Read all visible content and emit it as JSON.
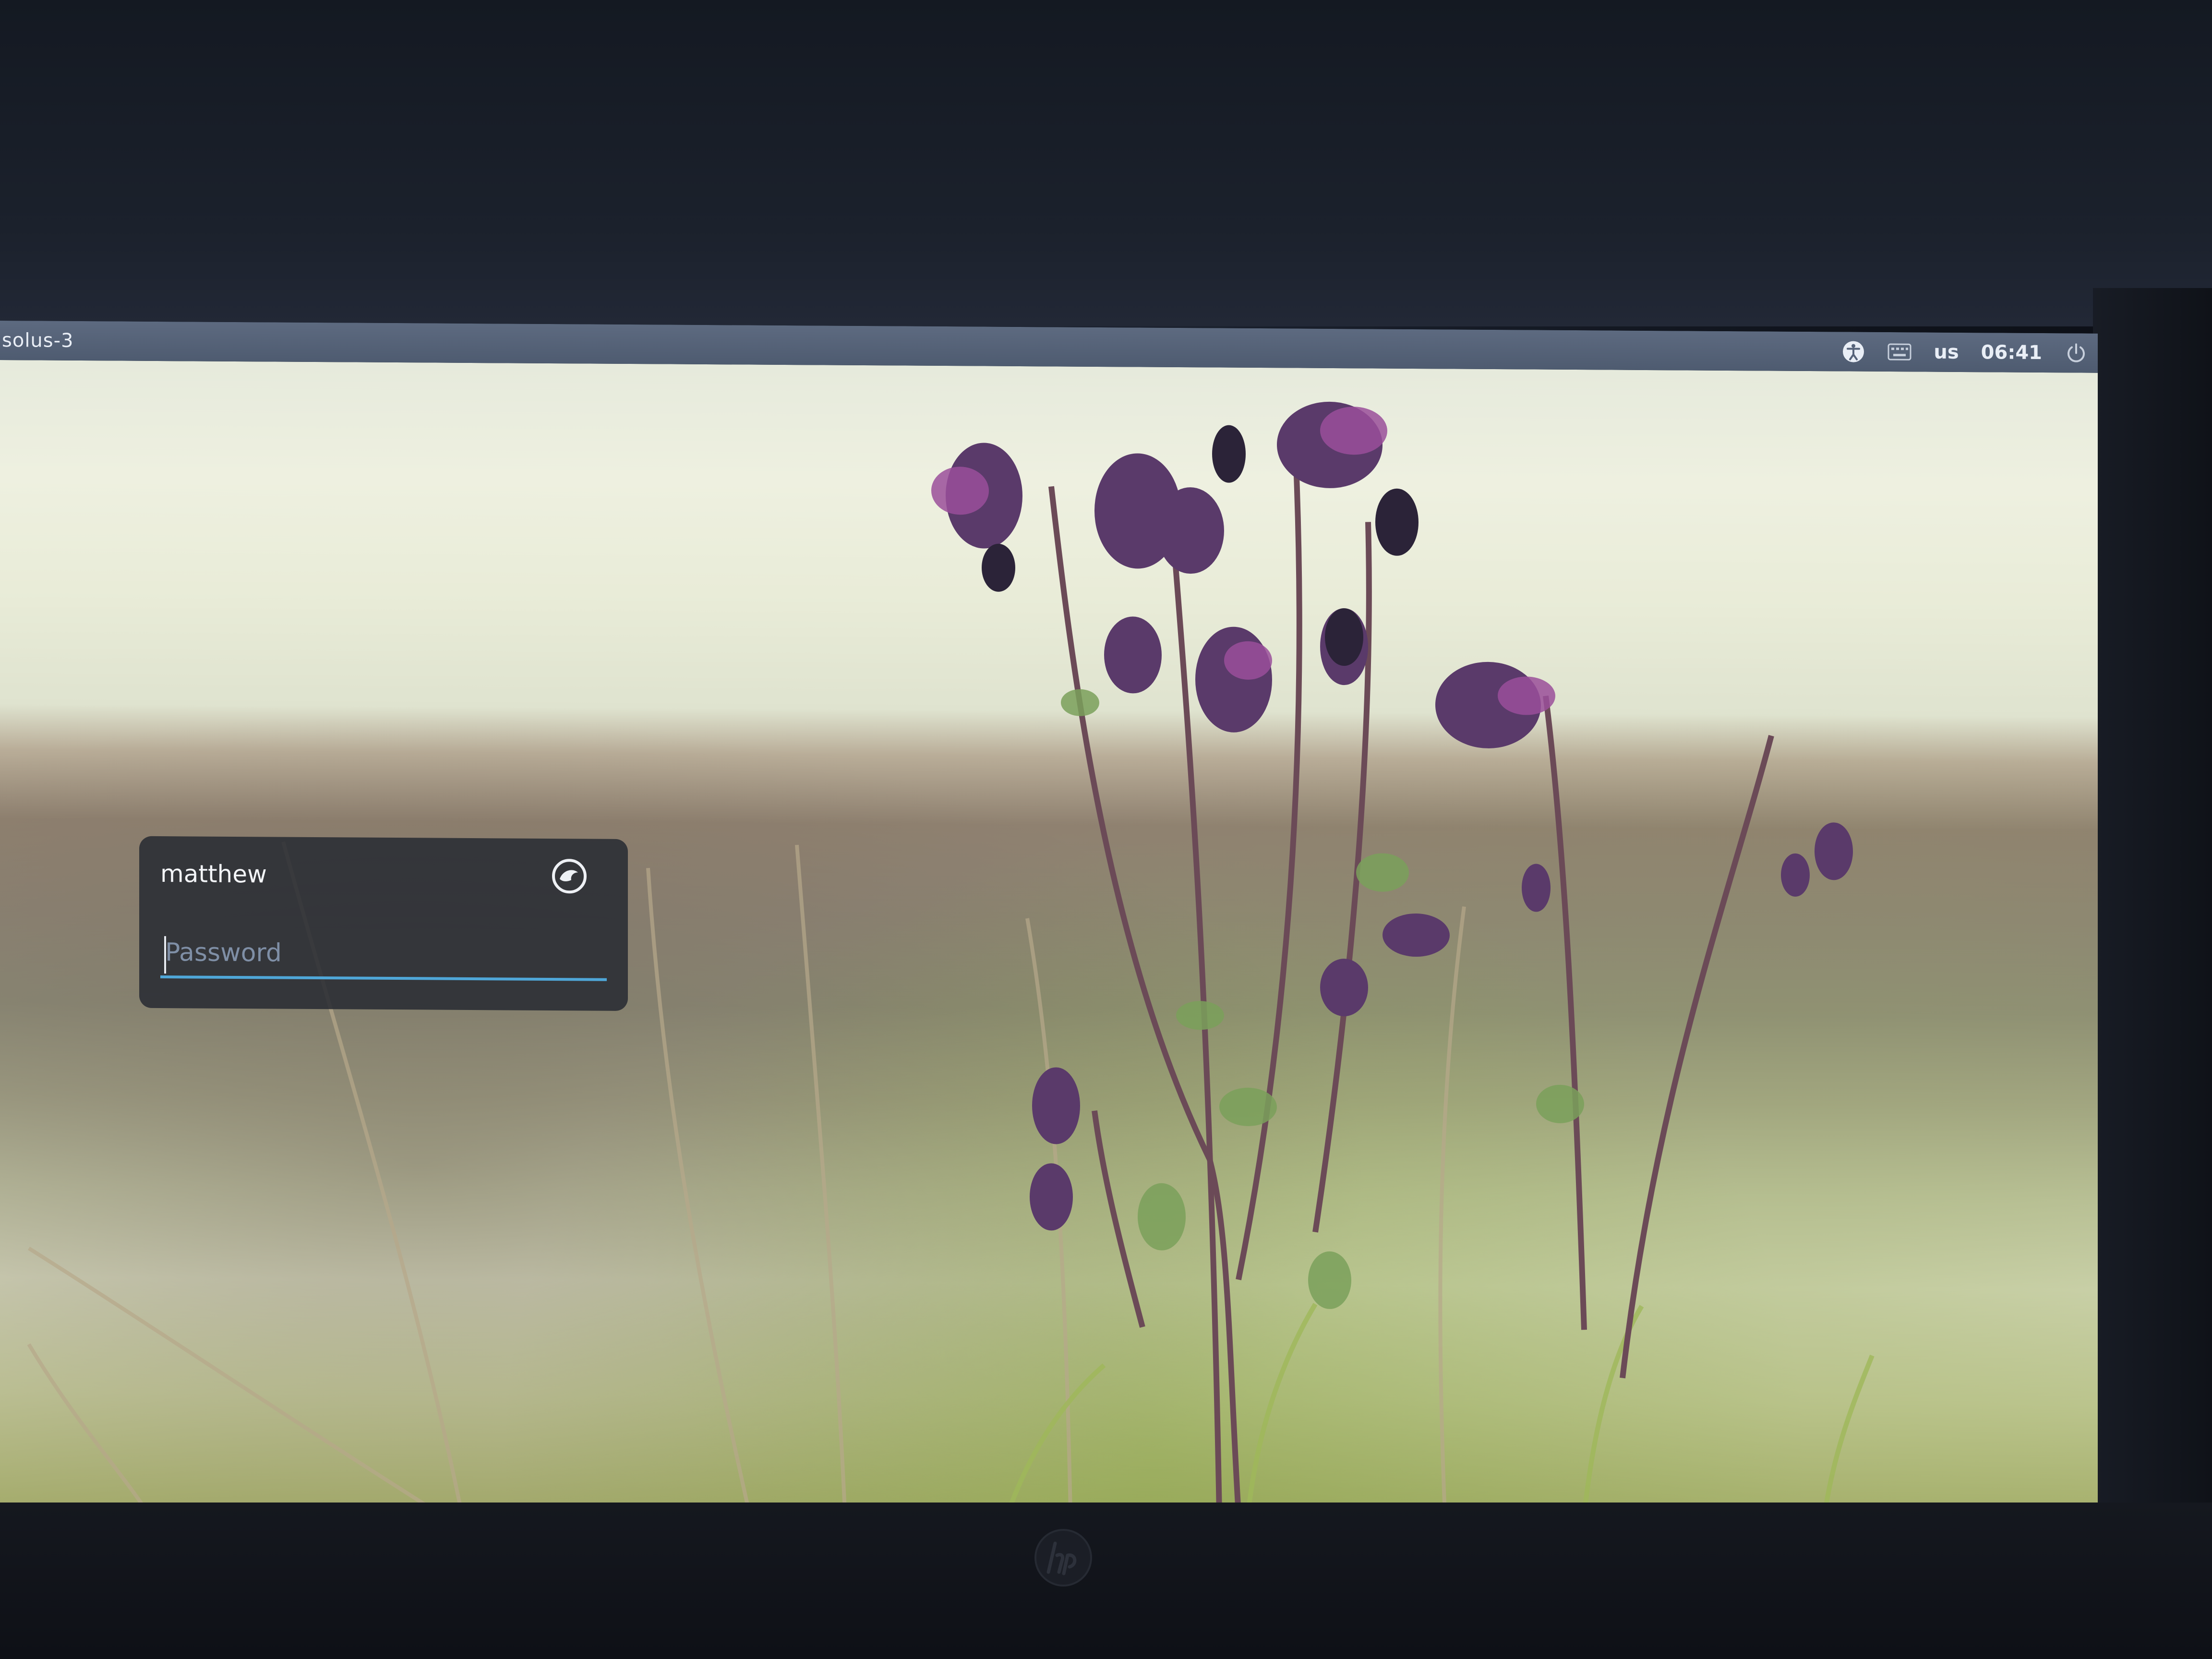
{
  "top_panel": {
    "hostname": "solus-3",
    "keyboard_layout": "us",
    "clock": "06:41",
    "icons": [
      "accessibility-icon",
      "keyboard-icon",
      "power-icon"
    ]
  },
  "login": {
    "username": "matthew",
    "password_placeholder": "Password",
    "password_value": "",
    "session_icon": "solus-session-icon"
  },
  "device": {
    "brand_logo": "hp"
  },
  "colors": {
    "panel": "#56637a",
    "card": "#262a32",
    "accent": "#4fa7d8",
    "placeholder": "#7f8fa6"
  }
}
